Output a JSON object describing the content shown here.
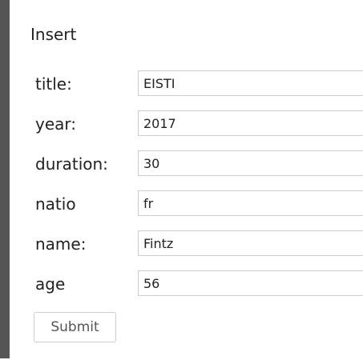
{
  "page": {
    "title": "Insert"
  },
  "form": {
    "fields": [
      {
        "label": "title:",
        "value": "EISTI"
      },
      {
        "label": "year:",
        "value": "2017"
      },
      {
        "label": "duration:",
        "value": "30"
      },
      {
        "label": "natio",
        "value": "fr"
      },
      {
        "label": "name:",
        "value": "Fintz"
      },
      {
        "label": "age",
        "value": "56"
      }
    ],
    "submit_label": "Submit"
  },
  "colors": {
    "sidebar_bar": "#555555",
    "input_border": "#cccccc",
    "text": "#222222"
  }
}
